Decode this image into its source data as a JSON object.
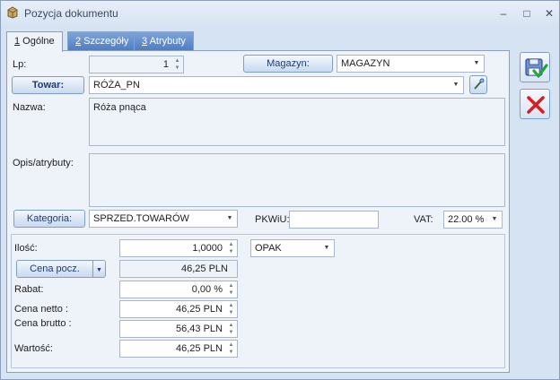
{
  "window": {
    "title": "Pozycja dokumentu",
    "minimize_glyph": "–",
    "maximize_glyph": "□",
    "close_glyph": "✕"
  },
  "tabs": [
    {
      "hotkey": "1",
      "rest": " Ogólne",
      "active": true
    },
    {
      "hotkey": "2",
      "rest": " Szczegóły",
      "active": false
    },
    {
      "hotkey": "3",
      "rest": " Atrybuty",
      "active": false
    }
  ],
  "form": {
    "lp_label": "Lp:",
    "lp_value": "1",
    "magazyn_button": "Magazyn:",
    "magazyn_value": "MAGAZYN",
    "towar_button": "Towar:",
    "towar_value": "RÓŻA_PN",
    "nazwa_label": "Nazwa:",
    "nazwa_value": "Róża pnąca",
    "opis_label": "Opis/atrybuty:",
    "opis_value": "",
    "kategoria_button": "Kategoria:",
    "kategoria_value": "SPRZED.TOWARÓW",
    "pkwiu_label": "PKWiU:",
    "pkwiu_value": "",
    "vat_label": "VAT:",
    "vat_value": "22.00 %"
  },
  "pricing": {
    "ilosc_label": "Ilość:",
    "ilosc_value": "1,0000",
    "jm_value": "OPAK",
    "cena_pocz_button": "Cena pocz.",
    "cena_pocz_value": "46,25 PLN",
    "rabat_label": "Rabat:",
    "rabat_value": "0,00 %",
    "cena_netto_label": "Cena netto :",
    "cena_netto_value": "46,25 PLN",
    "cena_brutto_label": "Cena brutto :",
    "cena_brutto_value": "56,43 PLN",
    "wartosc_label": "Wartość:",
    "wartosc_value": "46,25 PLN"
  },
  "icons": {
    "save": "save-check-icon",
    "cancel": "cancel-x-icon",
    "edit": "edit-wand-icon"
  },
  "colors": {
    "tab_inactive": "#5a86c9",
    "cancel_red": "#d81e1e",
    "save_green": "#27a33a",
    "save_blue": "#3a5fb0"
  }
}
